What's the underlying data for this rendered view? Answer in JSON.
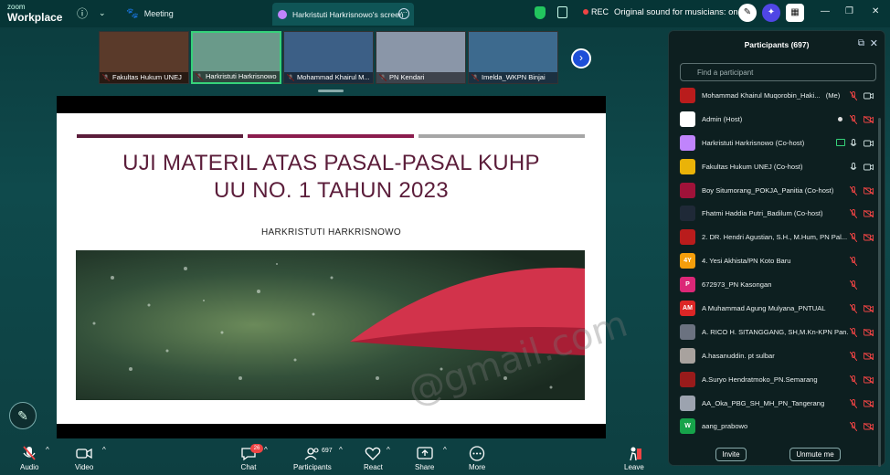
{
  "brand": {
    "line1": "zoom",
    "line2": "Workplace"
  },
  "topbar": {
    "meeting_label": "Meeting",
    "screen_tab": "Harkristuti Harkrisnowo's screen",
    "rec_label": "REC",
    "original_sound": "Original sound for musicians: on"
  },
  "thumbnails": [
    {
      "name": "Fakultas Hukum UNEJ",
      "bg": "#5a3a2a"
    },
    {
      "name": "Harkristuti Harkrisnowo",
      "bg": "#6a9a8a"
    },
    {
      "name": "Mohammad Khairul M...",
      "bg": "#3c5f86"
    },
    {
      "name": "PN Kendari",
      "bg": "#8a96a8"
    },
    {
      "name": "Imelda_WKPN Binjai",
      "bg": "#3d6a8e"
    }
  ],
  "slide": {
    "title_line1": "UJI MATERIL ATAS PASAL-PASAL KUHP",
    "title_line2": "UU NO. 1 TAHUN 2023",
    "author": "HARKRISTUTI HARKRISNOWO",
    "bar_colors": [
      "#5b1d3a",
      "#8b1d4e",
      "#a6a6a6"
    ],
    "watermark": "@gmail.com"
  },
  "panel": {
    "title": "Participants (697)",
    "search_placeholder": "Find a participant",
    "invite_label": "Invite",
    "unmute_label": "Unmute me",
    "participants": [
      {
        "name": "Mohammad Khairul Muqorobin_Haki...",
        "suffix": "(Me)",
        "avatar": "",
        "color": "#b91c1c",
        "mic": "muted",
        "cam": "on"
      },
      {
        "name": "Admin (Host)",
        "avatar": "",
        "color": "#ffffff",
        "mic": "muted",
        "cam": "off",
        "dot": true
      },
      {
        "name": "Harkristuti Harkrisnowo (Co-host)",
        "avatar": "",
        "color": "#c084fc",
        "mic": "on",
        "cam": "on",
        "share": true
      },
      {
        "name": "Fakultas Hukum UNEJ (Co-host)",
        "avatar": "",
        "color": "#eab308",
        "mic": "on",
        "cam": "on"
      },
      {
        "name": "Boy Situmorang_POKJA_Panitia (Co-host)",
        "avatar": "",
        "color": "#9f1239",
        "mic": "muted",
        "cam": "off"
      },
      {
        "name": "Fhatmi Haddia Putri_Badilum (Co-host)",
        "avatar": "",
        "color": "#1f2937",
        "mic": "muted",
        "cam": "off"
      },
      {
        "name": "2. DR. Hendri Agustian, S.H., M.Hum, PN Pal...",
        "avatar": "",
        "color": "#b91c1c",
        "mic": "muted",
        "cam": "off"
      },
      {
        "name": "4. Yesi Akhista/PN Koto Baru",
        "avatar": "4Y",
        "color": "#f59e0b",
        "mic": "muted",
        "cam": "none"
      },
      {
        "name": "672973_PN Kasongan",
        "avatar": "P",
        "color": "#db2777",
        "mic": "muted",
        "cam": "none"
      },
      {
        "name": "A Muhammad Agung Mulyana_PNTUAL",
        "avatar": "AM",
        "color": "#dc2626",
        "mic": "muted",
        "cam": "off"
      },
      {
        "name": "A. RICO H. SITANGGANG, SH,M.Kn-KPN Pan...",
        "avatar": "",
        "color": "#6b7280",
        "mic": "muted",
        "cam": "off"
      },
      {
        "name": "A.hasanuddin. pt sulbar",
        "avatar": "",
        "color": "#a8a29e",
        "mic": "muted",
        "cam": "off"
      },
      {
        "name": "A.Suryo Hendratmoko_PN.Semarang",
        "avatar": "",
        "color": "#991b1b",
        "mic": "muted",
        "cam": "off"
      },
      {
        "name": "AA_Oka_PBG_SH_MH_PN_Tangerang",
        "avatar": "",
        "color": "#9ca3af",
        "mic": "muted",
        "cam": "off"
      },
      {
        "name": "aang_prabowo",
        "avatar": "W",
        "color": "#16a34a",
        "mic": "muted",
        "cam": "off"
      }
    ]
  },
  "toolbar": {
    "audio": "Audio",
    "video": "Video",
    "chat": "Chat",
    "chat_badge": "26",
    "participants": "Participants",
    "participants_count": "697",
    "react": "React",
    "share": "Share",
    "more": "More",
    "leave": "Leave"
  },
  "colors": {
    "accent_green": "#36d27a",
    "danger": "#ef4444",
    "panel_bg": "#0d1f20"
  }
}
